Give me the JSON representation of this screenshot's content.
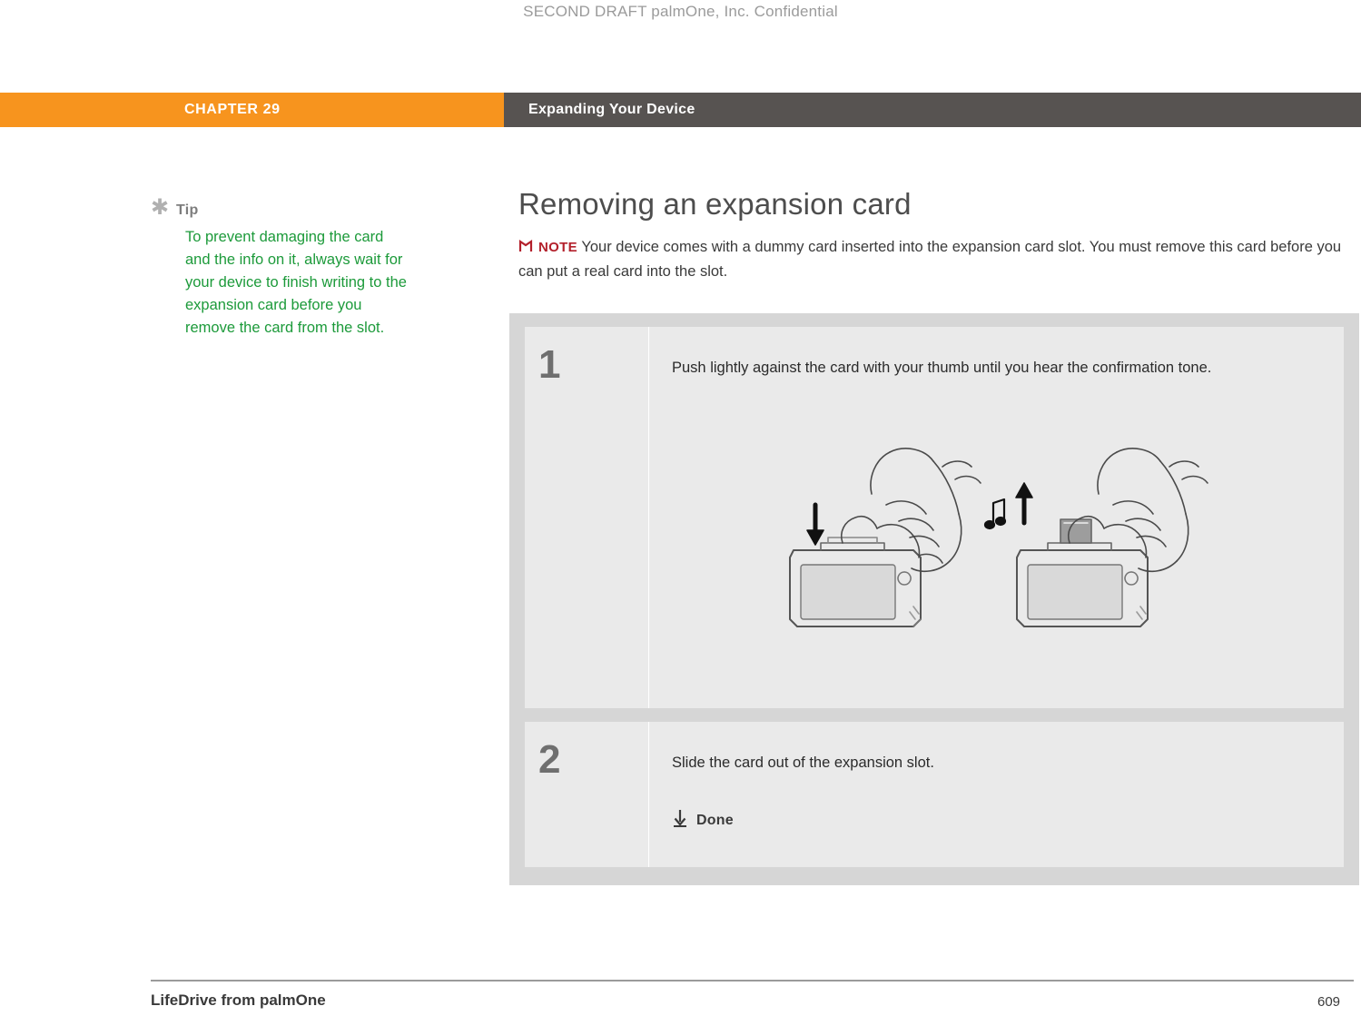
{
  "draft_header": "SECOND DRAFT palmOne, Inc.  Confidential",
  "chapter": {
    "number_label": "CHAPTER 29",
    "title": "Expanding Your Device",
    "accent_color": "#f7941e",
    "bar_color": "#575351"
  },
  "tip": {
    "icon": "asterisk-icon",
    "title": "Tip",
    "body": "To prevent damaging the card and the info on it, always wait for your device to finish writing to the expansion card before you remove the card from the slot.",
    "text_color": "#1c9a3a"
  },
  "main": {
    "title": "Removing an expansion card",
    "note": {
      "icon": "note-flag-icon",
      "badge": "NOTE",
      "badge_color": "#b3202b",
      "text": "Your device comes with a dummy card inserted into the expansion card slot. You must remove this card before you can put a real card into the slot."
    },
    "steps": [
      {
        "number": "1",
        "text": "Push lightly against the card with your thumb until you hear the confirmation tone.",
        "illustration": "hand-pushing-card-into-device-illustration"
      },
      {
        "number": "2",
        "text": "Slide the card out of the expansion slot.",
        "done_icon": "down-arrow-icon",
        "done_label": "Done"
      }
    ]
  },
  "footer": {
    "left": "LifeDrive from palmOne",
    "page_number": "609"
  }
}
